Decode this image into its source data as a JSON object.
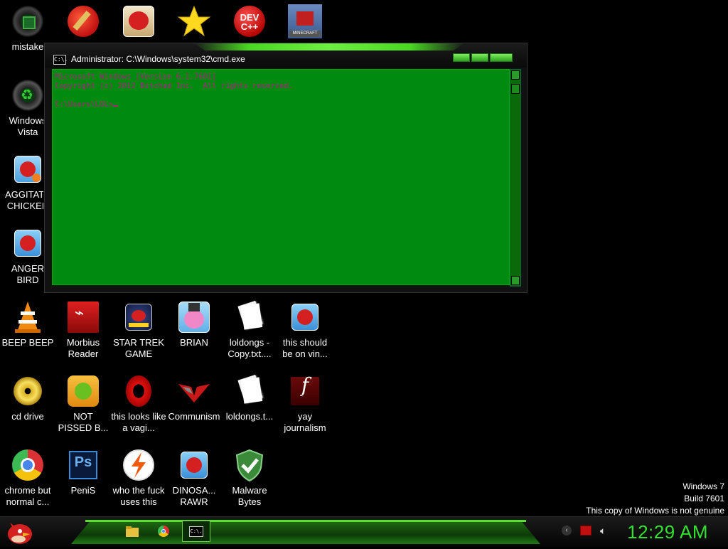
{
  "desktop_icons": [
    {
      "id": "mistake",
      "label": "mistake",
      "icon": "green-orb-icon"
    },
    {
      "id": "ccleaner",
      "label": "",
      "icon": "ccleaner-icon"
    },
    {
      "id": "seasons",
      "label": "",
      "icon": "angry-birds-seasons-icon"
    },
    {
      "id": "star",
      "label": "",
      "icon": "star-icon"
    },
    {
      "id": "devcpp",
      "label": "",
      "icon": "dev-cpp-icon",
      "text": "DEV\nC++"
    },
    {
      "id": "minecraft",
      "label": "",
      "icon": "minecraft-icon",
      "text": "MINECRAFT"
    },
    {
      "id": "windows-vista",
      "label": "Windows Vista",
      "icon": "recycle-bin-icon"
    },
    {
      "id": "aggitate",
      "label": "AGGITATE CHICKEN",
      "icon": "angry-birds-rio-icon"
    },
    {
      "id": "anger-bird",
      "label": "ANGER BIRD",
      "icon": "angry-birds-icon"
    },
    {
      "id": "beep-beep",
      "label": "BEEP BEEP",
      "icon": "vlc-cone-icon"
    },
    {
      "id": "morbius",
      "label": "Morbius Reader",
      "icon": "pdf-reader-icon"
    },
    {
      "id": "startrek",
      "label": "STAR TREK GAME",
      "icon": "angry-birds-star-wars-icon"
    },
    {
      "id": "brian",
      "label": "BRIAN",
      "icon": "bird-icon"
    },
    {
      "id": "loldongs-copy",
      "label": "loldongs - Copy.txt....",
      "icon": "text-file-icon"
    },
    {
      "id": "this-should",
      "label": "this should be on vin...",
      "icon": "angry-birds-icon"
    },
    {
      "id": "cd-drive",
      "label": "cd drive",
      "icon": "cd-drive-icon"
    },
    {
      "id": "not-pissed",
      "label": "NOT PISSED B...",
      "icon": "bad-piggies-icon"
    },
    {
      "id": "this-looks",
      "label": "this looks like a vagi...",
      "icon": "opera-icon"
    },
    {
      "id": "communism",
      "label": "Communism",
      "icon": "eagle-emblem-icon"
    },
    {
      "id": "loldongs",
      "label": "loldongs.t...",
      "icon": "text-file-icon"
    },
    {
      "id": "yay-journalism",
      "label": "yay journalism",
      "icon": "flash-icon",
      "text": "f"
    },
    {
      "id": "chrome",
      "label": "chrome but normal c...",
      "icon": "chrome-icon"
    },
    {
      "id": "penis",
      "label": "PeniS",
      "icon": "photoshop-icon",
      "text": "Ps"
    },
    {
      "id": "who-the",
      "label": "who the fuck uses this",
      "icon": "lightning-circle-icon"
    },
    {
      "id": "dinosa",
      "label": "DINOSA... RAWR",
      "icon": "angry-birds-icon"
    },
    {
      "id": "malware",
      "label": "Malware Bytes",
      "icon": "shield-check-icon"
    }
  ],
  "cmd_window": {
    "title": "Administrator: C:\\Windows\\system32\\cmd.exe",
    "icon_text": "C:\\.",
    "line1": "Microsoft Windows [Version 6.1.7601]",
    "line2": "Copyright (c) 2012 Bitchad Inc.  All rights reserved.",
    "prompt": "C:\\Users\\LOL>"
  },
  "watermark": {
    "line1": "Windows 7",
    "line2": "Build 7601",
    "line3": "This copy of Windows is not genuine"
  },
  "taskbar": {
    "clock": "12:29 AM",
    "items": [
      "folder-icon",
      "chrome-icon",
      "cmd-icon"
    ],
    "tray": [
      "show-hidden-icon",
      "flag-icon",
      "volume-icon"
    ]
  },
  "colors": {
    "console_bg": "#008a10",
    "console_text": "#b0207a",
    "clock": "#32e030",
    "accent": "#5ae030"
  }
}
